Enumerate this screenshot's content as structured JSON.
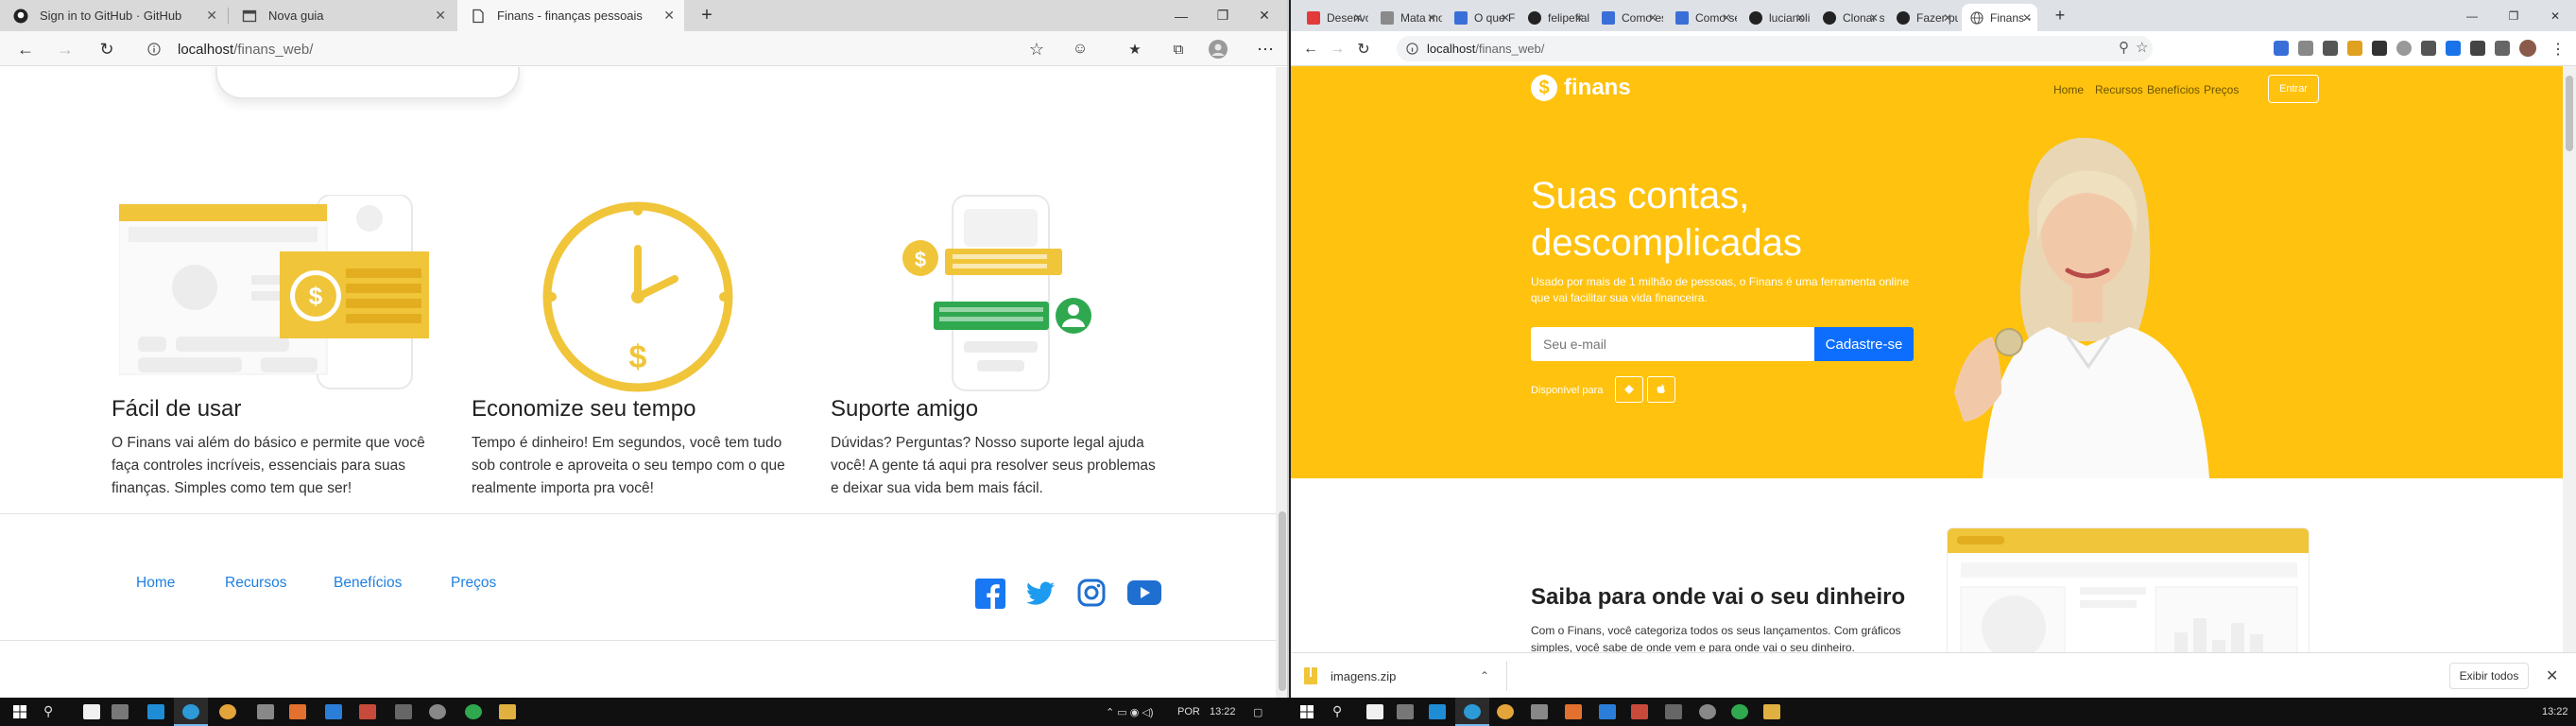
{
  "left_browser": {
    "tabs": [
      {
        "label": "Sign in to GitHub · GitHub",
        "icon": "github-icon"
      },
      {
        "label": "Nova guia",
        "icon": "new-tab-icon"
      },
      {
        "label": "Finans - finanças pessoais",
        "icon": "page-icon",
        "active": true
      }
    ],
    "url_host": "localhost",
    "url_path": "/finans_web/"
  },
  "left_page": {
    "features": [
      {
        "title": "Fácil de usar",
        "text": "O Finans vai além do básico e permite que você faça controles incríveis, essenciais para suas finanças. Simples como tem que ser!"
      },
      {
        "title": "Economize seu tempo",
        "text": "Tempo é dinheiro! Em segundos, você tem tudo sob controle e aproveita o seu tempo com o que realmente importa pra você!"
      },
      {
        "title": "Suporte amigo",
        "text": "Dúvidas? Perguntas? Nosso suporte legal ajuda você! A gente tá aqui pra resolver seus problemas e deixar sua vida bem mais fácil."
      }
    ],
    "footer_links": [
      "Home",
      "Recursos",
      "Benefícios",
      "Preços"
    ],
    "social_icons": [
      "facebook-icon",
      "twitter-icon",
      "instagram-icon",
      "youtube-icon"
    ]
  },
  "right_browser": {
    "tabs": [
      "Desenvo",
      "Mata mo",
      "O que Fr",
      "felipefiali",
      "Como es",
      "Como se",
      "lucianoli",
      "Clonar se",
      "Fazer pu",
      "Finans -"
    ],
    "url_host": "localhost",
    "url_path": "/finans_web/"
  },
  "right_page": {
    "logo_symbol": "$",
    "logo_name": "finans",
    "nav": [
      "Home",
      "Recursos",
      "Benefícios",
      "Preços"
    ],
    "login_label": "Entrar",
    "hero_title": "Suas contas, descomplicadas",
    "hero_sub": "Usado por mais de 1 milhão de pessoas, o Finans é uma ferramenta online que vai facilitar sua vida financeira.",
    "email_placeholder": "Seu e-mail",
    "signup_label": "Cadastre-se",
    "available_label": "Disponível para",
    "section_title": "Saiba para onde vai o seu dinheiro",
    "section_text": "Com o Finans, você categoriza todos os seus lançamentos. Com gráficos simples, você sabe de onde vem e para onde vai o seu dinheiro."
  },
  "downloads": {
    "file": "imagens.zip",
    "show_all": "Exibir todos"
  },
  "taskbar": {
    "left_lang": "POR",
    "left_time": "13:22",
    "right_time": "13:22"
  },
  "colors": {
    "brand_yellow": "#ffc20e",
    "illustration_yellow": "#f0c53a",
    "link_blue": "#1f7fe0",
    "cta_blue": "#0d6efd",
    "support_green": "#2fa84f"
  }
}
